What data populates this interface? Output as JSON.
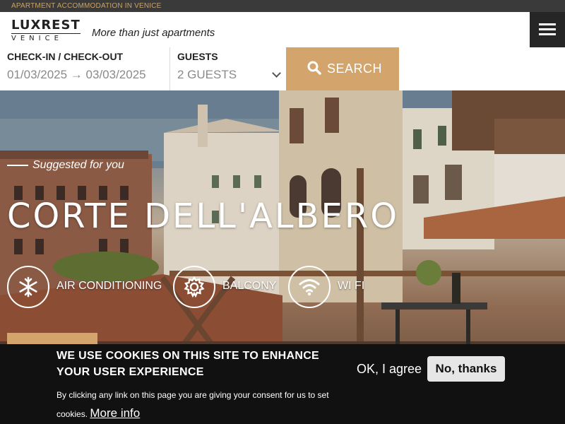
{
  "topbar": {
    "text": "APARTMENT ACCOMMODATION IN VENICE"
  },
  "header": {
    "logo_line1": "LUXREST",
    "logo_line2": "VENICE",
    "tagline": "More than just apartments",
    "menu_icon": "hamburger-icon"
  },
  "booking": {
    "dates_label": "CHECK-IN / CHECK-OUT",
    "dates_value": "01/03/2025 → 03/03/2025",
    "guests_label": "GUESTS",
    "guests_value": "2 GUESTS",
    "search_label": "SEARCH",
    "search_icon": "search-icon"
  },
  "hero": {
    "eyebrow": "Suggested for you",
    "title": "CORTE DELL'ALBERO",
    "amenities": [
      {
        "icon": "snowflake-icon",
        "label": "AIR CONDITIONING"
      },
      {
        "icon": "gear-icon",
        "label": "BALCONY"
      },
      {
        "icon": "wifi-icon",
        "label": "WI FI"
      }
    ]
  },
  "cookie": {
    "title": "WE USE COOKIES ON THIS SITE TO ENHANCE YOUR USER EXPERIENCE",
    "body": "By clicking any link on this page you are giving your consent for us to set cookies.",
    "more_info": "More info",
    "agree": "OK, I agree",
    "decline": "No, thanks"
  },
  "colors": {
    "accent": "#d3a46b",
    "dark": "#262626",
    "cookie_bg": "#111111"
  }
}
